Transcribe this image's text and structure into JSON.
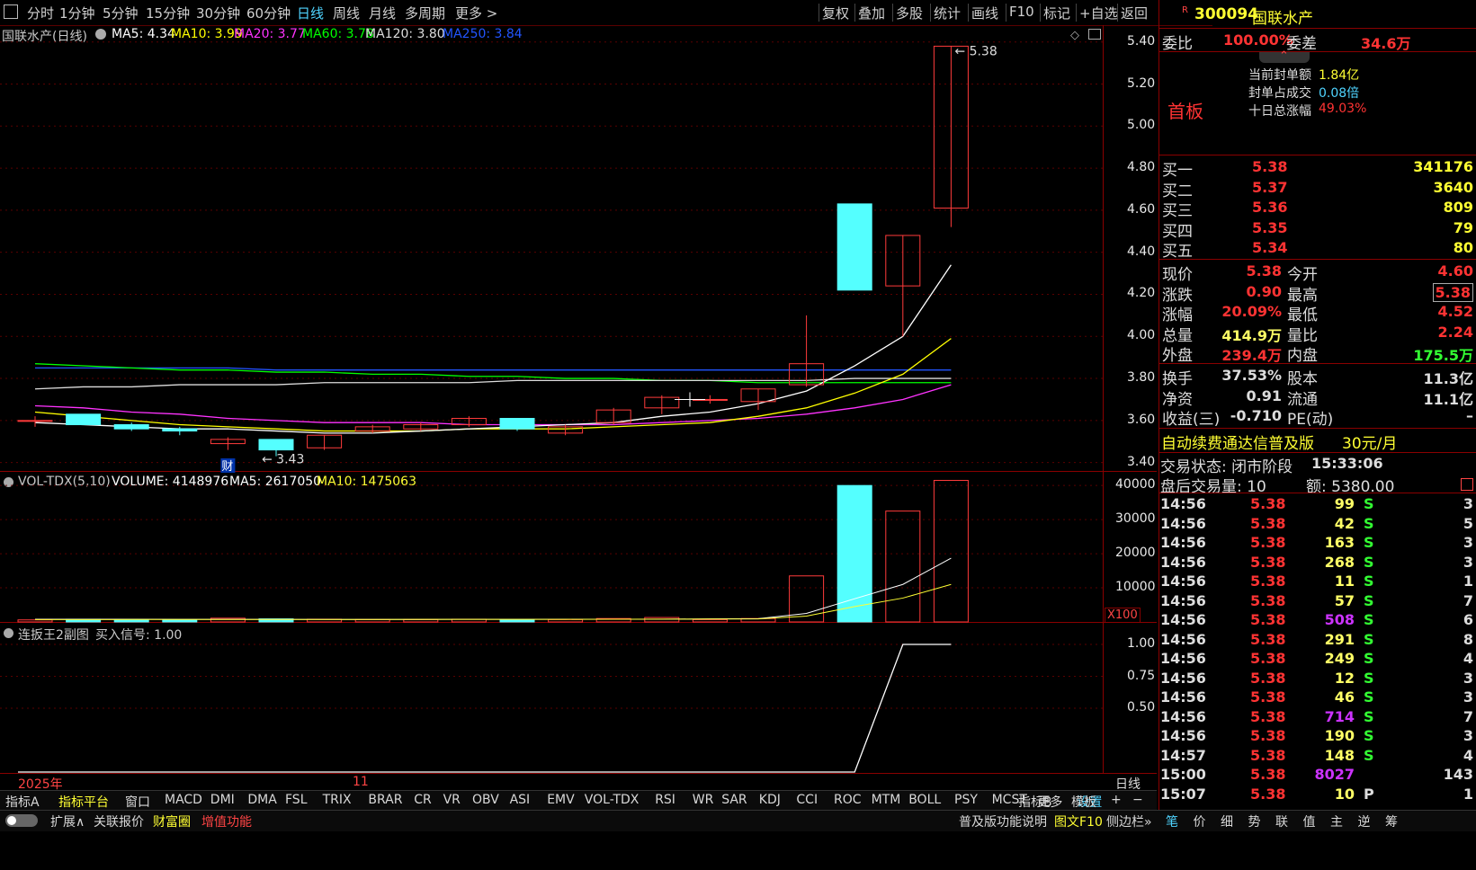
{
  "menu": {
    "periods": [
      "分时",
      "1分钟",
      "5分钟",
      "15分钟",
      "30分钟",
      "60分钟",
      "日线",
      "周线",
      "月线",
      "多周期",
      "更多 >"
    ],
    "active_period": "日线",
    "tools": [
      "复权",
      "叠加",
      "多股",
      "统计",
      "画线",
      "F10",
      "标记",
      "+自选",
      "返回"
    ]
  },
  "main_chart": {
    "title": "国联水产(日线)",
    "ma": [
      {
        "label": "MA5: 4.34",
        "color": "#ffffff"
      },
      {
        "label": "MA10: 3.99",
        "color": "#ffff00"
      },
      {
        "label": "MA20: 3.77",
        "color": "#ff33ff"
      },
      {
        "label": "MA60: 3.78",
        "color": "#00ff00"
      },
      {
        "label": "MA120: 3.80",
        "color": "#dddddd"
      },
      {
        "label": "MA250: 3.84",
        "color": "#2255ff"
      }
    ],
    "y_ticks": [
      "5.40",
      "5.20",
      "5.00",
      "4.80",
      "4.60",
      "4.40",
      "4.20",
      "4.00",
      "3.80",
      "3.60",
      "3.40"
    ],
    "high_label": "5.38",
    "low_label": "3.43",
    "cai_badge": "财"
  },
  "volume": {
    "title": "VOL-TDX(5,10)",
    "volume_label": "VOLUME: 4148976",
    "ma5_label": "MA5: 2617050",
    "ma10_label": "MA10: 1475063",
    "y_ticks": [
      "40000",
      "30000",
      "20000",
      "10000"
    ],
    "unit": "X100"
  },
  "indicator": {
    "title": "连扳王2副图",
    "signal_label": "买入信号: 1.00",
    "y_ticks": [
      "1.00",
      "0.75",
      "0.50"
    ]
  },
  "x_axis": {
    "year": "2025年",
    "month": "11",
    "period_label": "日线"
  },
  "quote": {
    "code": "300094",
    "name": "国联水产",
    "weibi_label": "委比",
    "weibi": "100.00%",
    "weicha_label": "委差",
    "weicha": "34.6万",
    "board": "首板",
    "seal_amount_label": "当前封单额",
    "seal_amount": "1.84亿",
    "seal_ratio_label": "封单占成交",
    "seal_ratio": "0.08倍",
    "ten_day_label": "十日总涨幅",
    "ten_day": "49.03%",
    "bids": [
      {
        "label": "买一",
        "price": "5.38",
        "vol": "341176"
      },
      {
        "label": "买二",
        "price": "5.37",
        "vol": "3640"
      },
      {
        "label": "买三",
        "price": "5.36",
        "vol": "809"
      },
      {
        "label": "买四",
        "price": "5.35",
        "vol": "79"
      },
      {
        "label": "买五",
        "price": "5.34",
        "vol": "80"
      }
    ],
    "stats": [
      {
        "l1": "现价",
        "v1": "5.38",
        "c1": "#ff3333",
        "l2": "今开",
        "v2": "4.60",
        "c2": "#ff3333"
      },
      {
        "l1": "涨跌",
        "v1": "0.90",
        "c1": "#ff3333",
        "l2": "最高",
        "v2": "5.38",
        "c2": "#ff3333"
      },
      {
        "l1": "涨幅",
        "v1": "20.09%",
        "c1": "#ff3333",
        "l2": "最低",
        "v2": "4.52",
        "c2": "#ff3333"
      },
      {
        "l1": "总量",
        "v1": "414.9万",
        "c1": "#ffff66",
        "l2": "量比",
        "v2": "2.24",
        "c2": "#ff3333"
      },
      {
        "l1": "外盘",
        "v1": "239.4万",
        "c1": "#ff3333",
        "l2": "内盘",
        "v2": "175.5万",
        "c2": "#33ff33"
      }
    ],
    "stats2": [
      {
        "l1": "换手",
        "v1": "37.53%",
        "l2": "股本",
        "v2": "11.3亿"
      },
      {
        "l1": "净资",
        "v1": "0.91",
        "l2": "流通",
        "v2": "11.1亿"
      },
      {
        "l1": "收益(三)",
        "v1": "-0.710",
        "l2": "PE(动)",
        "v2": "–"
      }
    ],
    "promo": "自动续费通达信普及版",
    "promo_price": "30元/月",
    "trade_status": "交易状态: 闭市阶段",
    "trade_time": "15:33:06",
    "after_hours": "盘后交易量: 10",
    "after_amount": "额: 5380.00"
  },
  "ticks": [
    {
      "t": "14:56",
      "p": "5.38",
      "v": "99",
      "vc": "#ffff66",
      "s": "S",
      "n": "3"
    },
    {
      "t": "14:56",
      "p": "5.38",
      "v": "42",
      "vc": "#ffff66",
      "s": "S",
      "n": "5"
    },
    {
      "t": "14:56",
      "p": "5.38",
      "v": "163",
      "vc": "#ffff66",
      "s": "S",
      "n": "3"
    },
    {
      "t": "14:56",
      "p": "5.38",
      "v": "268",
      "vc": "#ffff66",
      "s": "S",
      "n": "3"
    },
    {
      "t": "14:56",
      "p": "5.38",
      "v": "11",
      "vc": "#ffff66",
      "s": "S",
      "n": "1"
    },
    {
      "t": "14:56",
      "p": "5.38",
      "v": "57",
      "vc": "#ffff66",
      "s": "S",
      "n": "7"
    },
    {
      "t": "14:56",
      "p": "5.38",
      "v": "508",
      "vc": "#cc33ff",
      "s": "S",
      "n": "6"
    },
    {
      "t": "14:56",
      "p": "5.38",
      "v": "291",
      "vc": "#ffff66",
      "s": "S",
      "n": "8"
    },
    {
      "t": "14:56",
      "p": "5.38",
      "v": "249",
      "vc": "#ffff66",
      "s": "S",
      "n": "4"
    },
    {
      "t": "14:56",
      "p": "5.38",
      "v": "12",
      "vc": "#ffff66",
      "s": "S",
      "n": "3"
    },
    {
      "t": "14:56",
      "p": "5.38",
      "v": "46",
      "vc": "#ffff66",
      "s": "S",
      "n": "3"
    },
    {
      "t": "14:56",
      "p": "5.38",
      "v": "714",
      "vc": "#cc33ff",
      "s": "S",
      "n": "7"
    },
    {
      "t": "14:56",
      "p": "5.38",
      "v": "190",
      "vc": "#ffff66",
      "s": "S",
      "n": "3"
    },
    {
      "t": "14:57",
      "p": "5.38",
      "v": "148",
      "vc": "#ffff66",
      "s": "S",
      "n": "4"
    },
    {
      "t": "15:00",
      "p": "5.38",
      "v": "8027",
      "vc": "#cc33ff",
      "s": "",
      "n": "143"
    },
    {
      "t": "15:07",
      "p": "5.38",
      "v": "10",
      "vc": "#ffff66",
      "s": "P",
      "n": "1"
    }
  ],
  "indicator_tabs": [
    "指标A",
    "指标平台",
    "窗口",
    "MACD",
    "DMI",
    "DMA",
    "FSL",
    "TRIX",
    "BRAR",
    "CR",
    "VR",
    "OBV",
    "ASI",
    "EMV",
    "VOL-TDX",
    "RSI",
    "WR",
    "SAR",
    "KDJ",
    "CCI",
    "ROC",
    "MTM",
    "BOLL",
    "PSY",
    "MCST",
    "更多",
    "设置",
    "指标B",
    "模板",
    "+",
    "−"
  ],
  "bottom_links": [
    "扩展∧",
    "关联报价",
    "财富圈",
    "增值功能"
  ],
  "bottom_right": [
    "普及版功能说明",
    "图文F10",
    "侧边栏»"
  ],
  "side_tabs": [
    "笔",
    "价",
    "细",
    "势",
    "联",
    "值",
    "主",
    "逆",
    "筹"
  ],
  "chart_data": {
    "type": "candlestick",
    "candles": [
      {
        "o": 3.6,
        "c": 3.6,
        "h": 3.62,
        "l": 3.57
      },
      {
        "o": 3.63,
        "c": 3.58,
        "h": 3.63,
        "l": 3.58
      },
      {
        "o": 3.58,
        "c": 3.56,
        "h": 3.59,
        "l": 3.55
      },
      {
        "o": 3.56,
        "c": 3.55,
        "h": 3.57,
        "l": 3.53
      },
      {
        "o": 3.49,
        "c": 3.51,
        "h": 3.52,
        "l": 3.46
      },
      {
        "o": 3.51,
        "c": 3.46,
        "h": 3.51,
        "l": 3.43
      },
      {
        "o": 3.47,
        "c": 3.53,
        "h": 3.53,
        "l": 3.46
      },
      {
        "o": 3.55,
        "c": 3.57,
        "h": 3.58,
        "l": 3.54
      },
      {
        "o": 3.56,
        "c": 3.58,
        "h": 3.59,
        "l": 3.55
      },
      {
        "o": 3.58,
        "c": 3.61,
        "h": 3.62,
        "l": 3.57
      },
      {
        "o": 3.61,
        "c": 3.56,
        "h": 3.61,
        "l": 3.55
      },
      {
        "o": 3.54,
        "c": 3.57,
        "h": 3.58,
        "l": 3.53
      },
      {
        "o": 3.59,
        "c": 3.65,
        "h": 3.66,
        "l": 3.58
      },
      {
        "o": 3.66,
        "c": 3.71,
        "h": 3.72,
        "l": 3.63
      },
      {
        "o": 3.7,
        "c": 3.7,
        "h": 3.72,
        "l": 3.68
      },
      {
        "o": 3.69,
        "c": 3.75,
        "h": 3.75,
        "l": 3.65
      },
      {
        "o": 3.77,
        "c": 3.87,
        "h": 4.1,
        "l": 3.76
      },
      {
        "o": 4.63,
        "c": 4.22,
        "h": 4.63,
        "l": 4.22
      },
      {
        "o": 4.24,
        "c": 4.48,
        "h": 4.48,
        "l": 4.0
      },
      {
        "o": 4.61,
        "c": 5.38,
        "h": 5.38,
        "l": 4.52
      }
    ],
    "volume": [
      600,
      800,
      700,
      600,
      1100,
      900,
      800,
      700,
      700,
      800,
      600,
      700,
      1000,
      1300,
      700,
      1000,
      13500,
      40000,
      32500,
      41500
    ],
    "vol_ma5": [
      800,
      800,
      780,
      760,
      760,
      750,
      740,
      720,
      740,
      760,
      760,
      780,
      800,
      800,
      880,
      950,
      2500,
      6800,
      11000,
      18700
    ],
    "vol_ma10": [
      700,
      700,
      710,
      710,
      720,
      720,
      730,
      740,
      750,
      760,
      770,
      770,
      800,
      820,
      840,
      880,
      1700,
      4500,
      7000,
      11000
    ],
    "signal": [
      0,
      0,
      0,
      0,
      0,
      0,
      0,
      0,
      0,
      0,
      0,
      0,
      0,
      0,
      0,
      0,
      0,
      0,
      1,
      1
    ],
    "y_range": [
      3.36,
      5.48
    ],
    "vol_range": [
      0,
      44000
    ],
    "ma5": [
      3.59,
      3.58,
      3.57,
      3.56,
      3.56,
      3.55,
      3.54,
      3.54,
      3.55,
      3.56,
      3.57,
      3.58,
      3.59,
      3.62,
      3.64,
      3.68,
      3.74,
      3.86,
      4.0,
      4.34
    ],
    "ma10": [
      3.64,
      3.62,
      3.6,
      3.58,
      3.57,
      3.56,
      3.55,
      3.55,
      3.55,
      3.56,
      3.56,
      3.56,
      3.57,
      3.58,
      3.59,
      3.62,
      3.66,
      3.73,
      3.82,
      3.99
    ],
    "ma20": [
      3.67,
      3.66,
      3.64,
      3.63,
      3.61,
      3.6,
      3.59,
      3.59,
      3.59,
      3.58,
      3.58,
      3.58,
      3.58,
      3.59,
      3.6,
      3.61,
      3.63,
      3.66,
      3.7,
      3.77
    ],
    "ma60": [
      3.87,
      3.86,
      3.85,
      3.84,
      3.84,
      3.83,
      3.83,
      3.82,
      3.82,
      3.81,
      3.81,
      3.8,
      3.8,
      3.79,
      3.79,
      3.78,
      3.78,
      3.78,
      3.78,
      3.78
    ],
    "ma120": [
      3.75,
      3.76,
      3.76,
      3.77,
      3.77,
      3.77,
      3.78,
      3.78,
      3.78,
      3.78,
      3.79,
      3.79,
      3.79,
      3.79,
      3.79,
      3.79,
      3.79,
      3.8,
      3.8,
      3.8
    ],
    "ma250": [
      3.85,
      3.85,
      3.85,
      3.85,
      3.85,
      3.84,
      3.84,
      3.84,
      3.84,
      3.84,
      3.84,
      3.84,
      3.84,
      3.84,
      3.84,
      3.84,
      3.84,
      3.84,
      3.84,
      3.84
    ]
  }
}
